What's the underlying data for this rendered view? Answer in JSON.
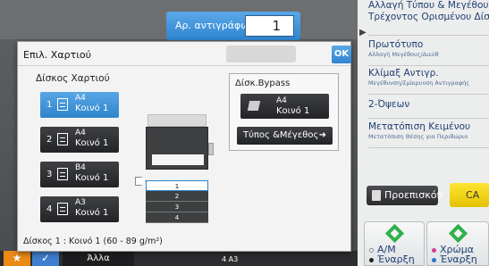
{
  "copies": {
    "label": "Αρ. αντιγράφων",
    "value": "1"
  },
  "right_panel": {
    "items": [
      {
        "title": "Αλλαγή Τύπου & Μεγέθους",
        "title2": "Τρέχοντος Ορισμένου Δίσκ",
        "sub": ""
      },
      {
        "title": "Πρωτότυπο",
        "title2": "",
        "sub": "Αλλαγή Μεγέθους/Διεύθ"
      },
      {
        "title": "Κλίμαξ Αντιγρ.",
        "title2": "",
        "sub": "Μεγέθυνση/Σμίκρυνση Αντιγραφής"
      },
      {
        "title": "2-Όψεων",
        "title2": "",
        "sub": ""
      },
      {
        "title": "Μετατόπιση Κειμένου",
        "title2": "",
        "sub": "Μετατόπιση Θέσης για Περιθώριο"
      }
    ]
  },
  "buttons": {
    "preview": "Προεπισκόπ",
    "ca": "CA"
  },
  "start": {
    "bw": {
      "line1": "A/M",
      "line2": "Έναρξη"
    },
    "color": {
      "line1": "Χρώμα",
      "line2": "Έναρξη"
    }
  },
  "bottom": {
    "star": "★",
    "check": "✓",
    "other": "Άλλα",
    "tray_hint": "4   A3"
  },
  "dialog": {
    "title": "Επιλ. Χαρτιού",
    "ok": "OK",
    "tray_heading": "Δίσκος Χαρτιού",
    "trays": [
      {
        "num": "1",
        "size": "A4",
        "type": "Κοινό 1",
        "selected": true
      },
      {
        "num": "2",
        "size": "A4",
        "type": "Κοινό 1",
        "selected": false
      },
      {
        "num": "3",
        "size": "B4",
        "type": "Κοινό 1",
        "selected": false
      },
      {
        "num": "4",
        "size": "A3",
        "type": "Κοινό 1",
        "selected": false
      }
    ],
    "bypass": {
      "title": "Δίσκ.Bypass",
      "size": "A4",
      "type": "Κοινό 1",
      "type_size_label": "Τύπος &Μέγεθος"
    },
    "machine_drawers": [
      "1",
      "2",
      "3",
      "4"
    ],
    "status": "Δίσκος 1 : Κοινό 1 (60 - 89 g/m²)"
  },
  "colors": {
    "accent": "#2f84cc",
    "ca": "#f1d400",
    "start_green": "#2fb04a"
  }
}
